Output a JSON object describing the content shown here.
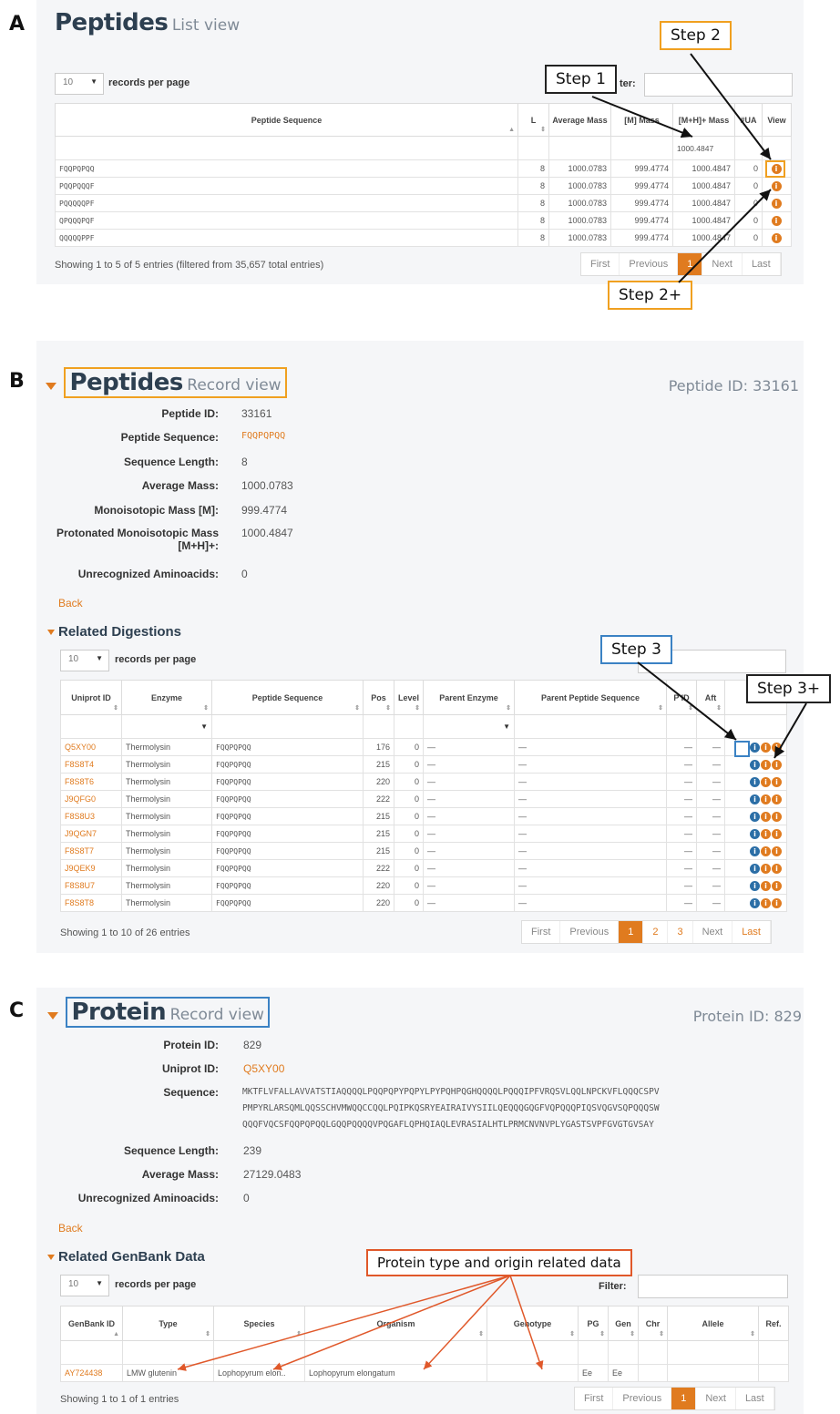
{
  "panel_a": {
    "letter": "A",
    "title": "Peptides",
    "subtitle": "List view",
    "records_select": "10",
    "records_label": "records per page",
    "filter_label": "ter:",
    "columns": [
      "Peptide Sequence",
      "L",
      "Average Mass",
      "[M] Mass",
      "[M+H]+ Mass",
      "#UA",
      "View"
    ],
    "filter_mass": "1000.4847",
    "rows": [
      [
        "FQQPQPQQ",
        "8",
        "1000.0783",
        "999.4774",
        "1000.4847",
        "0"
      ],
      [
        "PQQPQQQF",
        "8",
        "1000.0783",
        "999.4774",
        "1000.4847",
        "0"
      ],
      [
        "PQQQQQPF",
        "8",
        "1000.0783",
        "999.4774",
        "1000.4847",
        "0"
      ],
      [
        "QPQQQPQF",
        "8",
        "1000.0783",
        "999.4774",
        "1000.4847",
        "0"
      ],
      [
        "QQQQQPPF",
        "8",
        "1000.0783",
        "999.4774",
        "1000.4847",
        "0"
      ]
    ],
    "info": "Showing 1 to 5 of 5 entries (filtered from 35,657 total entries)",
    "pager": [
      "First",
      "Previous",
      "1",
      "Next",
      "Last"
    ],
    "callouts": {
      "step1": "Step 1",
      "step2": "Step 2",
      "step2plus": "Step 2+"
    }
  },
  "panel_b": {
    "letter": "B",
    "title": "Peptides",
    "subtitle": "Record view",
    "id_label": "Peptide ID: 33161",
    "fields": [
      {
        "k": "Peptide ID:",
        "v": "33161"
      },
      {
        "k": "Peptide Sequence:",
        "v": "FQQPQPQQ"
      },
      {
        "k": "Sequence Length:",
        "v": "8"
      },
      {
        "k": "Average Mass:",
        "v": "1000.0783"
      },
      {
        "k": "Monoisotopic Mass [M]:",
        "v": "999.4774"
      },
      {
        "k": "Protonated Monoisotopic Mass",
        "k2": "[M+H]+:",
        "v": "1000.4847"
      },
      {
        "k": "Unrecognized Aminoacids:",
        "v": "0"
      }
    ],
    "back": "Back",
    "section": "Related Digestions",
    "records_select": "10",
    "records_label": "records per page",
    "columns": [
      "Uniprot ID",
      "Enzyme",
      "Peptide Sequence",
      "Pos",
      "Level",
      "Parent Enzyme",
      "Parent Peptide Sequence",
      "P ID",
      "Aft"
    ],
    "rows": [
      [
        "Q5XY00",
        "Thermolysin",
        "FQQPQPQQ",
        "176",
        "0",
        "—",
        "—",
        "—",
        "—"
      ],
      [
        "F8S8T4",
        "Thermolysin",
        "FQQPQPQQ",
        "215",
        "0",
        "—",
        "—",
        "—",
        "—"
      ],
      [
        "F8S8T6",
        "Thermolysin",
        "FQQPQPQQ",
        "220",
        "0",
        "—",
        "—",
        "—",
        "—"
      ],
      [
        "J9QFG0",
        "Thermolysin",
        "FQQPQPQQ",
        "222",
        "0",
        "—",
        "—",
        "—",
        "—"
      ],
      [
        "F8S8U3",
        "Thermolysin",
        "FQQPQPQQ",
        "215",
        "0",
        "—",
        "—",
        "—",
        "—"
      ],
      [
        "J9QGN7",
        "Thermolysin",
        "FQQPQPQQ",
        "215",
        "0",
        "—",
        "—",
        "—",
        "—"
      ],
      [
        "F8S8T7",
        "Thermolysin",
        "FQQPQPQQ",
        "215",
        "0",
        "—",
        "—",
        "—",
        "—"
      ],
      [
        "J9QEK9",
        "Thermolysin",
        "FQQPQPQQ",
        "222",
        "0",
        "—",
        "—",
        "—",
        "—"
      ],
      [
        "F8S8U7",
        "Thermolysin",
        "FQQPQPQQ",
        "220",
        "0",
        "—",
        "—",
        "—",
        "—"
      ],
      [
        "F8S8T8",
        "Thermolysin",
        "FQQPQPQQ",
        "220",
        "0",
        "—",
        "—",
        "—",
        "—"
      ]
    ],
    "info": "Showing 1 to 10 of 26 entries",
    "pager": [
      "First",
      "Previous",
      "1",
      "2",
      "3",
      "Next",
      "Last"
    ],
    "callouts": {
      "step3": "Step 3",
      "step3plus": "Step 3+"
    }
  },
  "panel_c": {
    "letter": "C",
    "title": "Protein",
    "subtitle": "Record view",
    "id_label": "Protein ID: 829",
    "fields": [
      {
        "k": "Protein ID:",
        "v": "829"
      },
      {
        "k": "Uniprot ID:",
        "v": "Q5XY00"
      },
      {
        "k": "Sequence:",
        "v": ""
      },
      {
        "k": "Sequence Length:",
        "v": "239"
      },
      {
        "k": "Average Mass:",
        "v": "27129.0483"
      },
      {
        "k": "Unrecognized Aminoacids:",
        "v": "0"
      }
    ],
    "sequence": [
      "MKTFLVFALLAVVATSTIAQQQQLPQQPQPYPQPYLPYPQHPQGHQQQQLPQQQIPFVRQSVLQQLNPCKVFLQQQCSPV",
      "PMPYRLARSQMLQQSSCHVMWQQCCQQLPQIPKQSRYEAIRAIVYSIILQEQQQGQGFVQPQQQPIQSVQGVSQPQQQSW",
      "QQQFVQCSFQQPQPQQLGQQPQQQQVPQGAFLQPHQIAQLEVRASIALHTLPRMCNVNVPLYGASTSVPFGVGTGVSAY"
    ],
    "back": "Back",
    "section": "Related GenBank Data",
    "records_select": "10",
    "records_label": "records per page",
    "filter_label": "Filter:",
    "columns": [
      "GenBank ID",
      "Type",
      "Species",
      "Organism",
      "Genotype",
      "PG",
      "Gen",
      "Chr",
      "Allele",
      "Ref."
    ],
    "row": [
      "AY724438",
      "LMW glutenin",
      "Lophopyrum elon..",
      "Lophopyrum elongatum",
      "",
      "Ee",
      "Ee",
      "",
      "",
      ""
    ],
    "info": "Showing 1 to 1 of 1 entries",
    "pager": [
      "First",
      "Previous",
      "1",
      "Next",
      "Last"
    ],
    "callout": "Protein type and origin related data"
  },
  "colors": {
    "accent": "#e07b1f",
    "blue": "#2b6ea6",
    "title": "#2d3f50",
    "panel": "#f5f6f8"
  }
}
